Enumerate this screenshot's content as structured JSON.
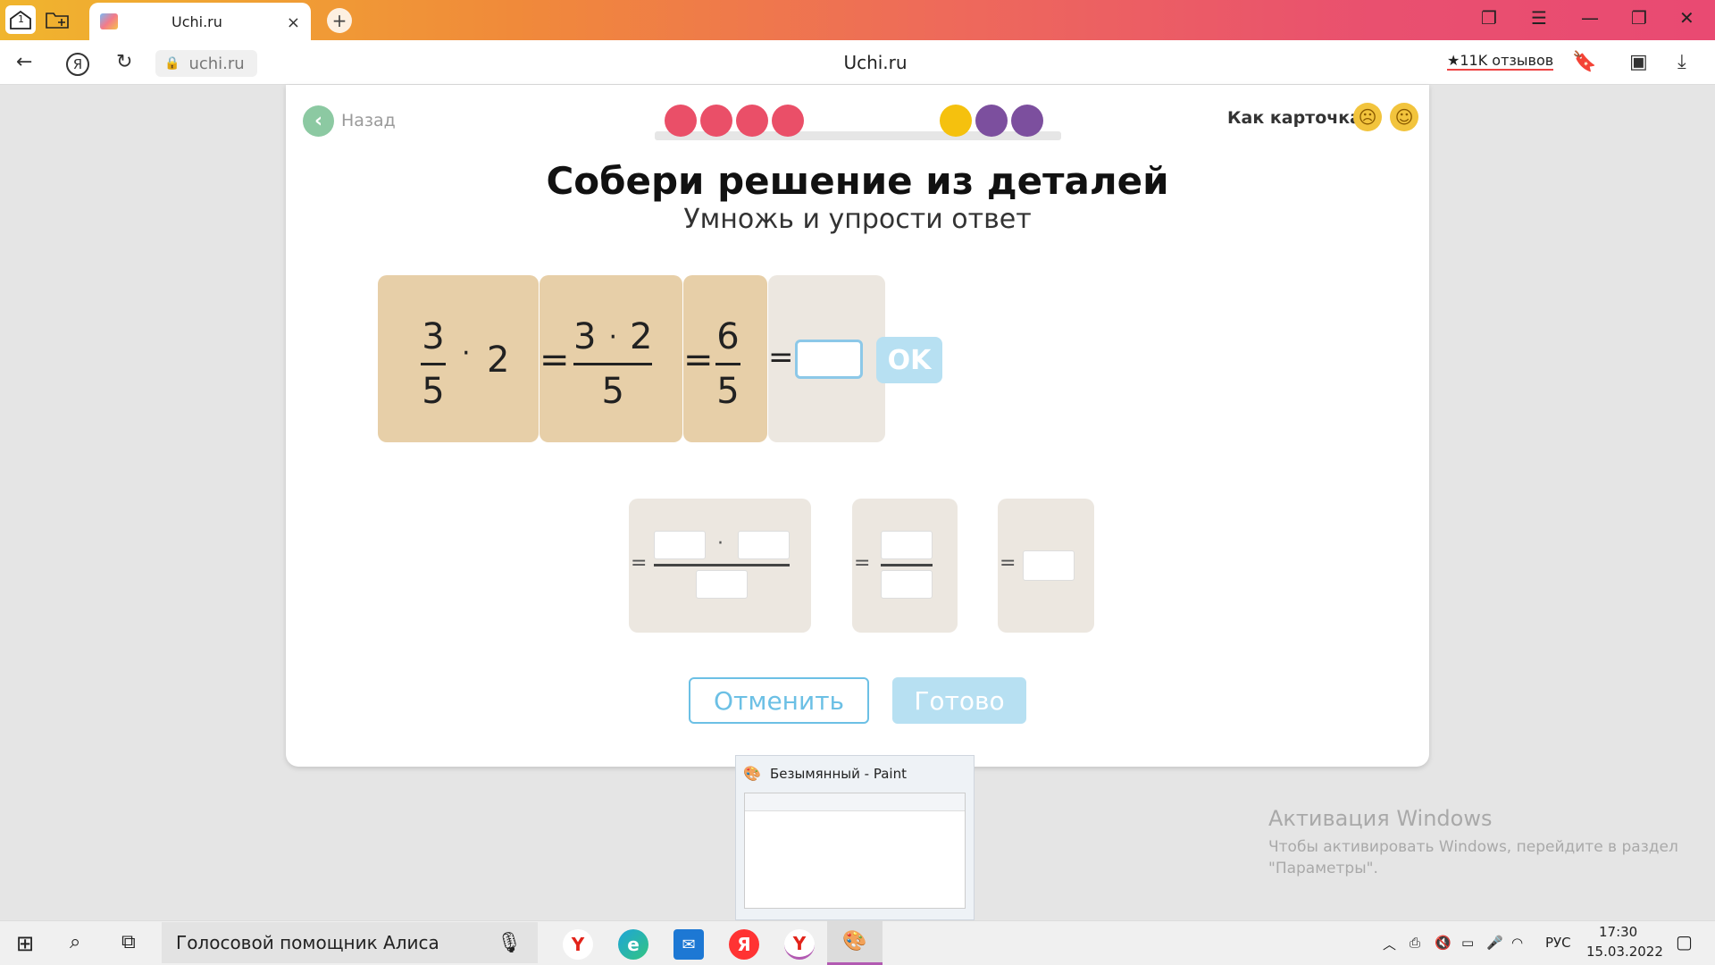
{
  "browser": {
    "tab_title": "Uchi.ru",
    "tab_count": "1",
    "url": "uchi.ru",
    "page_title": "Uchi.ru",
    "reviews": "11K отзывов",
    "close_tab": "×",
    "new_tab": "+"
  },
  "card": {
    "back_label": "Назад",
    "rate_label": "Как карточка?",
    "title": "Собери решение из деталей",
    "subtitle": "Умножь и упрости ответ",
    "progress_colors": [
      "#ea4f68",
      "#ea4f68",
      "#ea4f68",
      "#ea4f68",
      "#f5c10e",
      "#7c4f9e",
      "#7c4f9e"
    ],
    "expr": {
      "piece1": {
        "num": "3",
        "den": "5",
        "op": "·",
        "factor": "2"
      },
      "piece2": {
        "eq": "=",
        "num_a": "3",
        "op": "·",
        "num_b": "2",
        "den": "5"
      },
      "piece3": {
        "eq": "=",
        "num": "6",
        "den": "5"
      },
      "piece4": {
        "eq": "="
      }
    },
    "ok_label": "OK",
    "options_eq": "=",
    "options_op": "·",
    "cancel_label": "Отменить",
    "done_label": "Готово"
  },
  "paint_preview": {
    "title": "Безымянный - Paint"
  },
  "watermark": {
    "title": "Активация Windows",
    "text": "Чтобы активировать Windows, перейдите в раздел \"Параметры\"."
  },
  "taskbar": {
    "search": "Голосовой помощник Алиса",
    "lang": "РУС",
    "time": "17:30",
    "date": "15.03.2022"
  }
}
